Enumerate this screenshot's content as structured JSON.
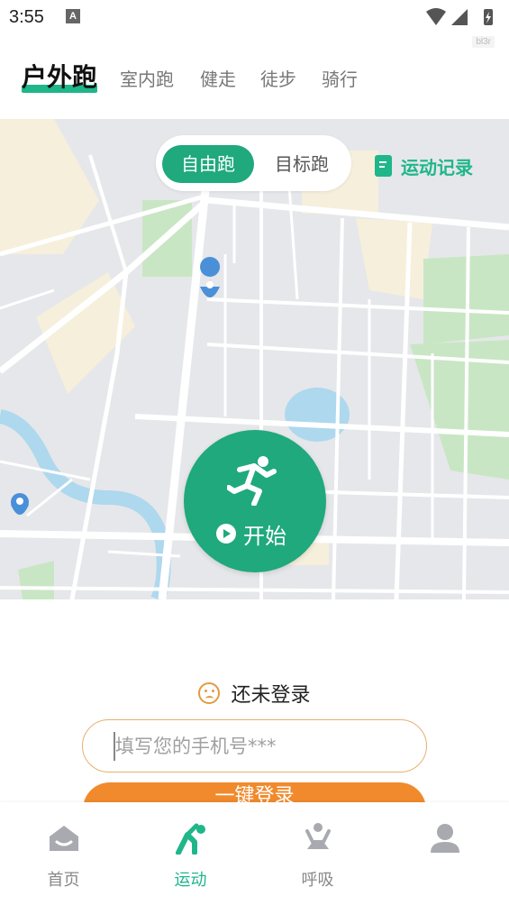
{
  "status_bar": {
    "time": "3:55",
    "notification_letter": "A",
    "watermark": "bl3r"
  },
  "top_tabs": [
    {
      "label": "户外跑",
      "active": true
    },
    {
      "label": "室内跑",
      "active": false
    },
    {
      "label": "健走",
      "active": false
    },
    {
      "label": "徒步",
      "active": false
    },
    {
      "label": "骑行",
      "active": false
    }
  ],
  "map": {
    "mode_switch": {
      "active": "自由跑",
      "inactive": "目标跑"
    },
    "records_label": "运动记录",
    "start_label": "开始",
    "accent_color": "#1fa97c"
  },
  "login": {
    "status_text": "还未登录",
    "phone_placeholder": "填写您的手机号***",
    "login_button": "一键登录"
  },
  "bottom_nav": [
    {
      "label": "首页",
      "icon": "home-icon",
      "active": false
    },
    {
      "label": "运动",
      "icon": "exercise-icon",
      "active": true
    },
    {
      "label": "呼吸",
      "icon": "meditation-icon",
      "active": false
    },
    {
      "label": "",
      "icon": "profile-icon",
      "active": false
    }
  ]
}
